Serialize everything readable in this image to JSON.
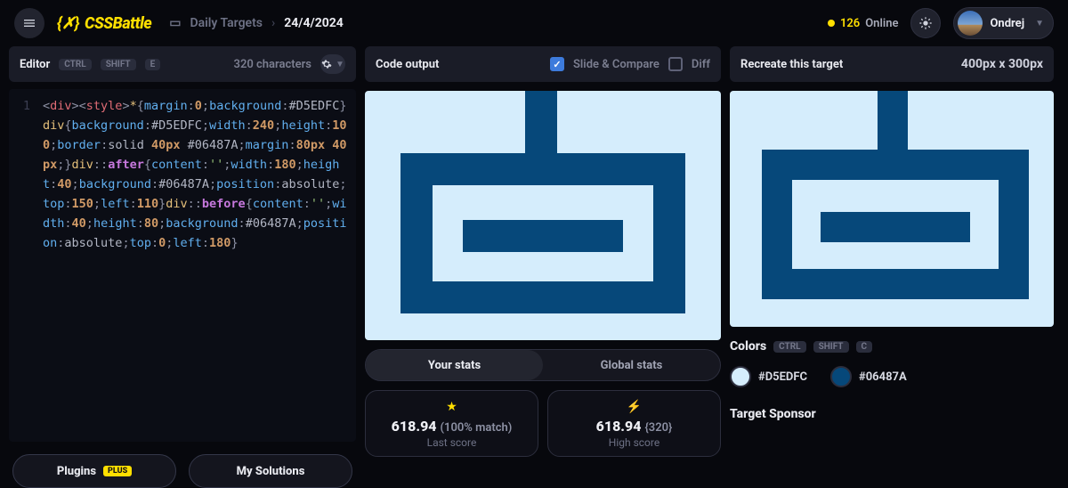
{
  "header": {
    "logo": "CSSBattle",
    "breadcrumb_root": "Daily Targets",
    "breadcrumb_current": "24/4/2024",
    "online_count": "126",
    "online_label": "Online",
    "username": "Ondrej"
  },
  "editor": {
    "title": "Editor",
    "kbd1": "CTRL",
    "kbd2": "SHIFT",
    "kbd3": "E",
    "char_count": "320 characters",
    "buttons": {
      "plugins": "Plugins",
      "plus_badge": "PLUS",
      "solutions": "My Solutions"
    }
  },
  "code": {
    "tokens": [
      {
        "c": "t-punc",
        "t": "<"
      },
      {
        "c": "t-tag",
        "t": "div"
      },
      {
        "c": "t-punc",
        "t": "><"
      },
      {
        "c": "t-tag",
        "t": "style"
      },
      {
        "c": "t-punc",
        "t": ">"
      },
      {
        "c": "t-sel",
        "t": "*"
      },
      {
        "c": "t-punc",
        "t": "{"
      },
      {
        "c": "t-prop",
        "t": "margin"
      },
      {
        "c": "t-punc",
        "t": ":"
      },
      {
        "c": "t-num",
        "t": "0"
      },
      {
        "c": "t-punc",
        "t": ";"
      },
      {
        "c": "t-prop",
        "t": "background"
      },
      {
        "c": "t-punc",
        "t": ":"
      },
      {
        "c": "t-hex",
        "t": "#D5EDFC"
      },
      {
        "c": "t-punc",
        "t": "}"
      },
      {
        "c": "t-sel",
        "t": "div"
      },
      {
        "c": "t-punc",
        "t": "{"
      },
      {
        "c": "t-prop",
        "t": "background"
      },
      {
        "c": "t-punc",
        "t": ":"
      },
      {
        "c": "t-hex",
        "t": "#D5EDFC"
      },
      {
        "c": "t-punc",
        "t": ";"
      },
      {
        "c": "t-prop",
        "t": "width"
      },
      {
        "c": "t-punc",
        "t": ":"
      },
      {
        "c": "t-num",
        "t": "240"
      },
      {
        "c": "t-punc",
        "t": ";"
      },
      {
        "c": "t-prop",
        "t": "height"
      },
      {
        "c": "t-punc",
        "t": ":"
      },
      {
        "c": "t-num",
        "t": "100"
      },
      {
        "c": "t-punc",
        "t": ";"
      },
      {
        "c": "t-prop",
        "t": "border"
      },
      {
        "c": "t-punc",
        "t": ":"
      },
      {
        "c": "t-hex",
        "t": "solid "
      },
      {
        "c": "t-num",
        "t": "40px"
      },
      {
        "c": "t-hex",
        "t": " #06487A"
      },
      {
        "c": "t-punc",
        "t": ";"
      },
      {
        "c": "t-prop",
        "t": "margin"
      },
      {
        "c": "t-punc",
        "t": ":"
      },
      {
        "c": "t-num",
        "t": "80px 40px"
      },
      {
        "c": "t-punc",
        "t": ";}"
      },
      {
        "c": "t-sel",
        "t": "div"
      },
      {
        "c": "t-punc",
        "t": "::"
      },
      {
        "c": "t-pseudo",
        "t": "after"
      },
      {
        "c": "t-punc",
        "t": "{"
      },
      {
        "c": "t-prop",
        "t": "content"
      },
      {
        "c": "t-punc",
        "t": ":"
      },
      {
        "c": "t-str",
        "t": "''"
      },
      {
        "c": "t-punc",
        "t": ";"
      },
      {
        "c": "t-prop",
        "t": "width"
      },
      {
        "c": "t-punc",
        "t": ":"
      },
      {
        "c": "t-num",
        "t": "180"
      },
      {
        "c": "t-punc",
        "t": ";"
      },
      {
        "c": "t-prop",
        "t": "height"
      },
      {
        "c": "t-punc",
        "t": ":"
      },
      {
        "c": "t-num",
        "t": "40"
      },
      {
        "c": "t-punc",
        "t": ";"
      },
      {
        "c": "t-prop",
        "t": "background"
      },
      {
        "c": "t-punc",
        "t": ":"
      },
      {
        "c": "t-hex",
        "t": "#06487A"
      },
      {
        "c": "t-punc",
        "t": ";"
      },
      {
        "c": "t-prop",
        "t": "position"
      },
      {
        "c": "t-punc",
        "t": ":"
      },
      {
        "c": "t-hex",
        "t": "absolute"
      },
      {
        "c": "t-punc",
        "t": ";"
      },
      {
        "c": "t-prop",
        "t": "top"
      },
      {
        "c": "t-punc",
        "t": ":"
      },
      {
        "c": "t-num",
        "t": "150"
      },
      {
        "c": "t-punc",
        "t": ";"
      },
      {
        "c": "t-prop",
        "t": "left"
      },
      {
        "c": "t-punc",
        "t": ":"
      },
      {
        "c": "t-num",
        "t": "110"
      },
      {
        "c": "t-punc",
        "t": "}"
      },
      {
        "c": "t-sel",
        "t": "div"
      },
      {
        "c": "t-punc",
        "t": "::"
      },
      {
        "c": "t-pseudo",
        "t": "before"
      },
      {
        "c": "t-punc",
        "t": "{"
      },
      {
        "c": "t-prop",
        "t": "content"
      },
      {
        "c": "t-punc",
        "t": ":"
      },
      {
        "c": "t-str",
        "t": "''"
      },
      {
        "c": "t-punc",
        "t": ";"
      },
      {
        "c": "t-prop",
        "t": "width"
      },
      {
        "c": "t-punc",
        "t": ":"
      },
      {
        "c": "t-num",
        "t": "40"
      },
      {
        "c": "t-punc",
        "t": ";"
      },
      {
        "c": "t-prop",
        "t": "height"
      },
      {
        "c": "t-punc",
        "t": ":"
      },
      {
        "c": "t-num",
        "t": "80"
      },
      {
        "c": "t-punc",
        "t": ";"
      },
      {
        "c": "t-prop",
        "t": "background"
      },
      {
        "c": "t-punc",
        "t": ":"
      },
      {
        "c": "t-hex",
        "t": "#06487A"
      },
      {
        "c": "t-punc",
        "t": ";"
      },
      {
        "c": "t-prop",
        "t": "position"
      },
      {
        "c": "t-punc",
        "t": ":"
      },
      {
        "c": "t-hex",
        "t": "absolute"
      },
      {
        "c": "t-punc",
        "t": ";"
      },
      {
        "c": "t-prop",
        "t": "top"
      },
      {
        "c": "t-punc",
        "t": ":"
      },
      {
        "c": "t-num",
        "t": "0"
      },
      {
        "c": "t-punc",
        "t": ";"
      },
      {
        "c": "t-prop",
        "t": "left"
      },
      {
        "c": "t-punc",
        "t": ":"
      },
      {
        "c": "t-num",
        "t": "180"
      },
      {
        "c": "t-punc",
        "t": "}"
      }
    ]
  },
  "output": {
    "title": "Code output",
    "slide_label": "Slide & Compare",
    "diff_label": "Diff",
    "tabs": {
      "your": "Your stats",
      "global": "Global stats"
    },
    "stats": {
      "last": {
        "score": "618.94",
        "sub": "(100% match)",
        "label": "Last score"
      },
      "high": {
        "score": "618.94",
        "sub": "{320}",
        "label": "High score"
      }
    }
  },
  "target": {
    "title": "Recreate this target",
    "dimensions": "400px x 300px",
    "colors_title": "Colors",
    "kbd1": "CTRL",
    "kbd2": "SHIFT",
    "kbd3": "C",
    "swatches": [
      {
        "hex": "#D5EDFC"
      },
      {
        "hex": "#06487A"
      }
    ],
    "sponsor_title": "Target Sponsor"
  }
}
